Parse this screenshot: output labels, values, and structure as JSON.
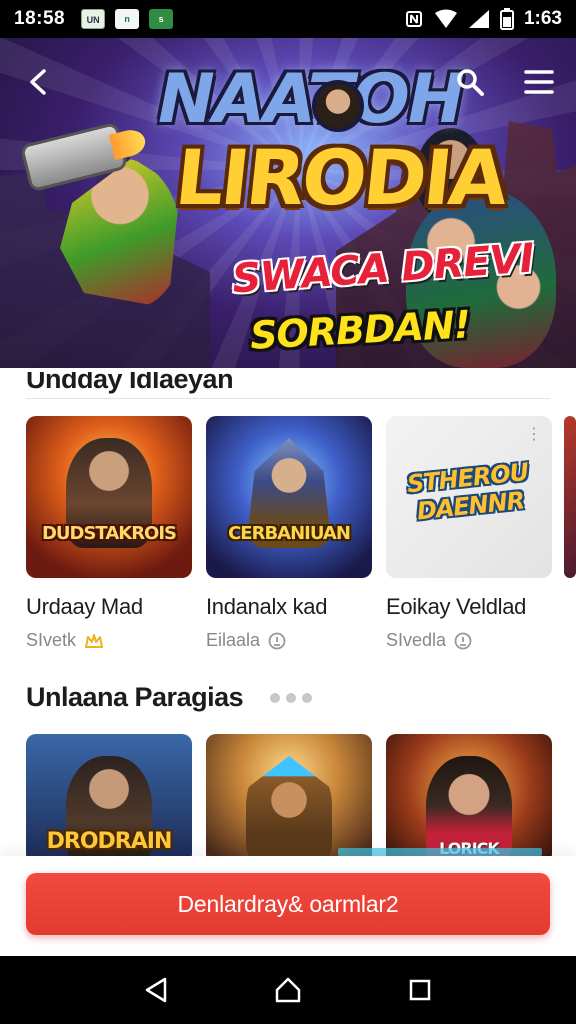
{
  "status_bar": {
    "time": "18:58",
    "notifications": [
      "UN",
      "n",
      "s"
    ],
    "clock": "1:63"
  },
  "hero": {
    "logo_top": "NAATOH",
    "logo_main": "LIRODIA",
    "tagline_1": "SWACA DREVI",
    "tagline_2": "SORBDAN!"
  },
  "section_1": {
    "title": "Undday Idlaeyan",
    "cards": [
      {
        "name": "Urdaay Mad",
        "meta": "SIvetk",
        "thumb_title": "DUDSTAKROIS"
      },
      {
        "name": "Indanalx kad",
        "meta": "Eilaala",
        "thumb_title": "CERBANIUAN"
      },
      {
        "name": "Eoikay Veldlad",
        "meta": "SIvedla",
        "thumb_title": "STHEROU DAENNR"
      },
      {
        "name": "E",
        "meta": "S"
      }
    ]
  },
  "section_2": {
    "title": "Unlaana Paragias",
    "cards": [
      {
        "thumb_title": "DRODRAIN"
      },
      {
        "thumb_title": ""
      },
      {
        "thumb_title": "LORICK"
      }
    ]
  },
  "cta": {
    "label": "Denlardray& oarmlar2"
  },
  "colors": {
    "accent": "#e8413a",
    "status_bar": "#000000",
    "text_primary": "#1c1c1c",
    "text_secondary": "#888888"
  },
  "icons": {
    "back": "arrow-left",
    "search": "magnifier",
    "menu": "hamburger",
    "nav_back": "triangle-left",
    "nav_home": "home",
    "nav_recents": "square"
  }
}
